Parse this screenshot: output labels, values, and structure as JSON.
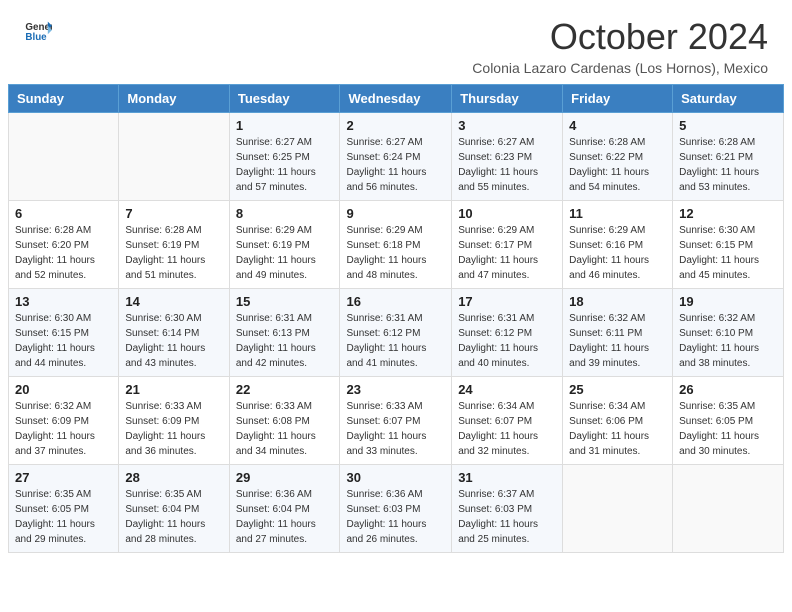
{
  "header": {
    "logo_line1": "General",
    "logo_line2": "Blue",
    "month_title": "October 2024",
    "subtitle": "Colonia Lazaro Cardenas (Los Hornos), Mexico"
  },
  "weekdays": [
    "Sunday",
    "Monday",
    "Tuesday",
    "Wednesday",
    "Thursday",
    "Friday",
    "Saturday"
  ],
  "weeks": [
    [
      {
        "day": "",
        "sunrise": "",
        "sunset": "",
        "daylight": ""
      },
      {
        "day": "",
        "sunrise": "",
        "sunset": "",
        "daylight": ""
      },
      {
        "day": "1",
        "sunrise": "Sunrise: 6:27 AM",
        "sunset": "Sunset: 6:25 PM",
        "daylight": "Daylight: 11 hours and 57 minutes."
      },
      {
        "day": "2",
        "sunrise": "Sunrise: 6:27 AM",
        "sunset": "Sunset: 6:24 PM",
        "daylight": "Daylight: 11 hours and 56 minutes."
      },
      {
        "day": "3",
        "sunrise": "Sunrise: 6:27 AM",
        "sunset": "Sunset: 6:23 PM",
        "daylight": "Daylight: 11 hours and 55 minutes."
      },
      {
        "day": "4",
        "sunrise": "Sunrise: 6:28 AM",
        "sunset": "Sunset: 6:22 PM",
        "daylight": "Daylight: 11 hours and 54 minutes."
      },
      {
        "day": "5",
        "sunrise": "Sunrise: 6:28 AM",
        "sunset": "Sunset: 6:21 PM",
        "daylight": "Daylight: 11 hours and 53 minutes."
      }
    ],
    [
      {
        "day": "6",
        "sunrise": "Sunrise: 6:28 AM",
        "sunset": "Sunset: 6:20 PM",
        "daylight": "Daylight: 11 hours and 52 minutes."
      },
      {
        "day": "7",
        "sunrise": "Sunrise: 6:28 AM",
        "sunset": "Sunset: 6:19 PM",
        "daylight": "Daylight: 11 hours and 51 minutes."
      },
      {
        "day": "8",
        "sunrise": "Sunrise: 6:29 AM",
        "sunset": "Sunset: 6:19 PM",
        "daylight": "Daylight: 11 hours and 49 minutes."
      },
      {
        "day": "9",
        "sunrise": "Sunrise: 6:29 AM",
        "sunset": "Sunset: 6:18 PM",
        "daylight": "Daylight: 11 hours and 48 minutes."
      },
      {
        "day": "10",
        "sunrise": "Sunrise: 6:29 AM",
        "sunset": "Sunset: 6:17 PM",
        "daylight": "Daylight: 11 hours and 47 minutes."
      },
      {
        "day": "11",
        "sunrise": "Sunrise: 6:29 AM",
        "sunset": "Sunset: 6:16 PM",
        "daylight": "Daylight: 11 hours and 46 minutes."
      },
      {
        "day": "12",
        "sunrise": "Sunrise: 6:30 AM",
        "sunset": "Sunset: 6:15 PM",
        "daylight": "Daylight: 11 hours and 45 minutes."
      }
    ],
    [
      {
        "day": "13",
        "sunrise": "Sunrise: 6:30 AM",
        "sunset": "Sunset: 6:15 PM",
        "daylight": "Daylight: 11 hours and 44 minutes."
      },
      {
        "day": "14",
        "sunrise": "Sunrise: 6:30 AM",
        "sunset": "Sunset: 6:14 PM",
        "daylight": "Daylight: 11 hours and 43 minutes."
      },
      {
        "day": "15",
        "sunrise": "Sunrise: 6:31 AM",
        "sunset": "Sunset: 6:13 PM",
        "daylight": "Daylight: 11 hours and 42 minutes."
      },
      {
        "day": "16",
        "sunrise": "Sunrise: 6:31 AM",
        "sunset": "Sunset: 6:12 PM",
        "daylight": "Daylight: 11 hours and 41 minutes."
      },
      {
        "day": "17",
        "sunrise": "Sunrise: 6:31 AM",
        "sunset": "Sunset: 6:12 PM",
        "daylight": "Daylight: 11 hours and 40 minutes."
      },
      {
        "day": "18",
        "sunrise": "Sunrise: 6:32 AM",
        "sunset": "Sunset: 6:11 PM",
        "daylight": "Daylight: 11 hours and 39 minutes."
      },
      {
        "day": "19",
        "sunrise": "Sunrise: 6:32 AM",
        "sunset": "Sunset: 6:10 PM",
        "daylight": "Daylight: 11 hours and 38 minutes."
      }
    ],
    [
      {
        "day": "20",
        "sunrise": "Sunrise: 6:32 AM",
        "sunset": "Sunset: 6:09 PM",
        "daylight": "Daylight: 11 hours and 37 minutes."
      },
      {
        "day": "21",
        "sunrise": "Sunrise: 6:33 AM",
        "sunset": "Sunset: 6:09 PM",
        "daylight": "Daylight: 11 hours and 36 minutes."
      },
      {
        "day": "22",
        "sunrise": "Sunrise: 6:33 AM",
        "sunset": "Sunset: 6:08 PM",
        "daylight": "Daylight: 11 hours and 34 minutes."
      },
      {
        "day": "23",
        "sunrise": "Sunrise: 6:33 AM",
        "sunset": "Sunset: 6:07 PM",
        "daylight": "Daylight: 11 hours and 33 minutes."
      },
      {
        "day": "24",
        "sunrise": "Sunrise: 6:34 AM",
        "sunset": "Sunset: 6:07 PM",
        "daylight": "Daylight: 11 hours and 32 minutes."
      },
      {
        "day": "25",
        "sunrise": "Sunrise: 6:34 AM",
        "sunset": "Sunset: 6:06 PM",
        "daylight": "Daylight: 11 hours and 31 minutes."
      },
      {
        "day": "26",
        "sunrise": "Sunrise: 6:35 AM",
        "sunset": "Sunset: 6:05 PM",
        "daylight": "Daylight: 11 hours and 30 minutes."
      }
    ],
    [
      {
        "day": "27",
        "sunrise": "Sunrise: 6:35 AM",
        "sunset": "Sunset: 6:05 PM",
        "daylight": "Daylight: 11 hours and 29 minutes."
      },
      {
        "day": "28",
        "sunrise": "Sunrise: 6:35 AM",
        "sunset": "Sunset: 6:04 PM",
        "daylight": "Daylight: 11 hours and 28 minutes."
      },
      {
        "day": "29",
        "sunrise": "Sunrise: 6:36 AM",
        "sunset": "Sunset: 6:04 PM",
        "daylight": "Daylight: 11 hours and 27 minutes."
      },
      {
        "day": "30",
        "sunrise": "Sunrise: 6:36 AM",
        "sunset": "Sunset: 6:03 PM",
        "daylight": "Daylight: 11 hours and 26 minutes."
      },
      {
        "day": "31",
        "sunrise": "Sunrise: 6:37 AM",
        "sunset": "Sunset: 6:03 PM",
        "daylight": "Daylight: 11 hours and 25 minutes."
      },
      {
        "day": "",
        "sunrise": "",
        "sunset": "",
        "daylight": ""
      },
      {
        "day": "",
        "sunrise": "",
        "sunset": "",
        "daylight": ""
      }
    ]
  ]
}
